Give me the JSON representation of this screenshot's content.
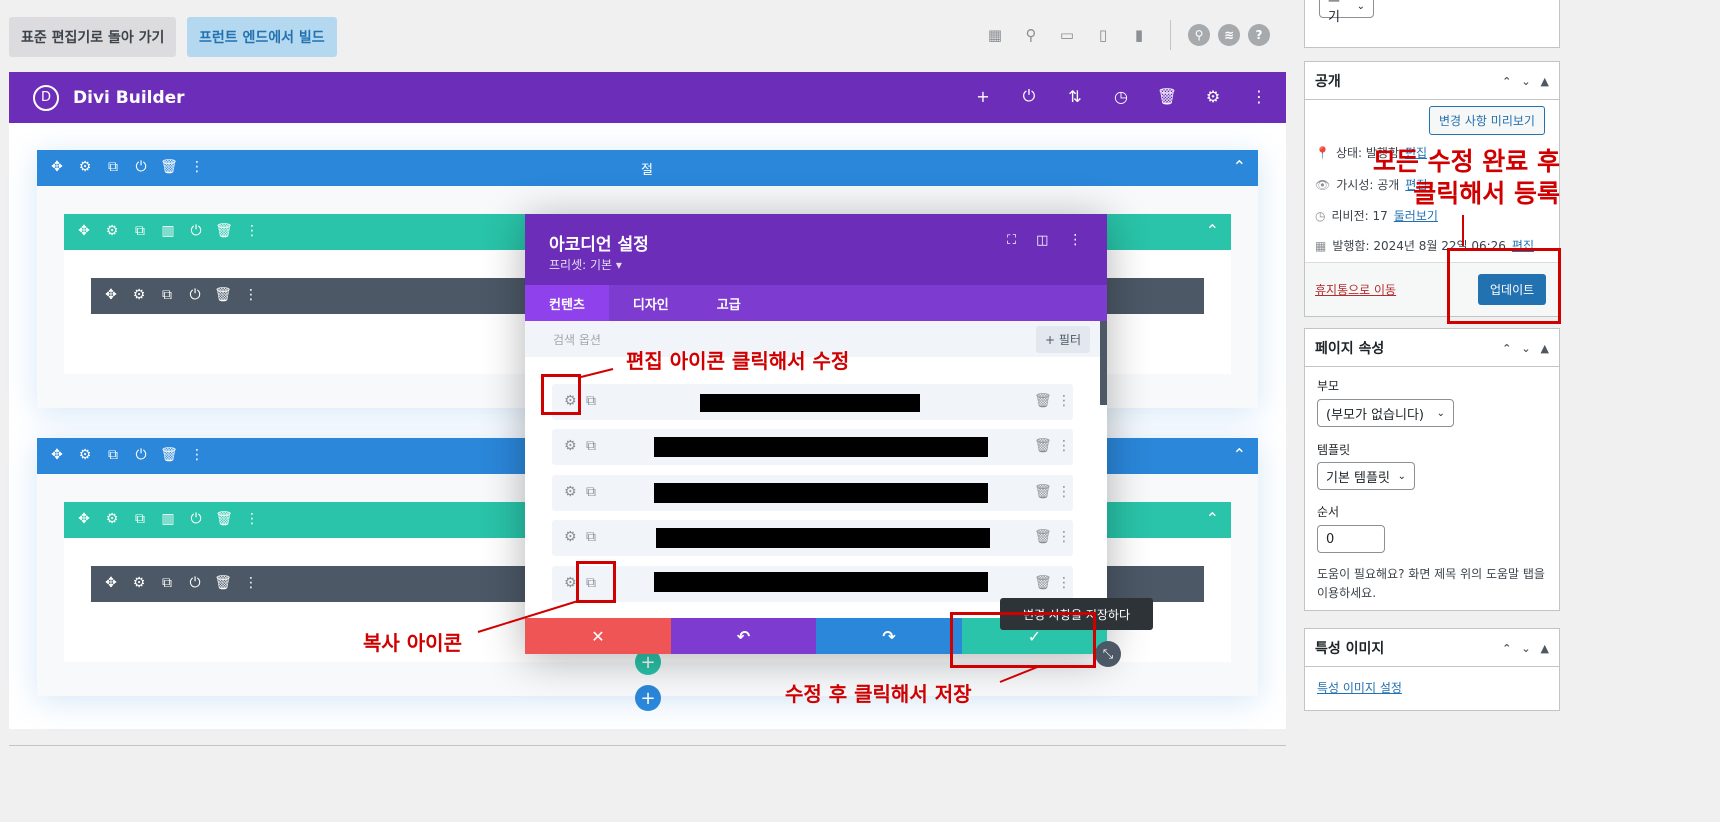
{
  "toolbar": {
    "back_label": "표준 편집기로 돌아 가기",
    "frontend_label": "프런트 엔드에서 빌드",
    "help_icon": "?"
  },
  "divi": {
    "title": "Divi Builder",
    "logo": "D",
    "section_label": "절"
  },
  "modal": {
    "title": "아코디언 설정",
    "preset": "프리셋: 기본 ▾",
    "tabs": [
      "컨텐츠",
      "디자인",
      "고급"
    ],
    "search_placeholder": "검색 옵션",
    "filter_label": "+ 필터",
    "tooltip": "변경 사항을 저장하다"
  },
  "sidebar": {
    "top_select": "끄기",
    "publish": {
      "title": "공개",
      "preview_btn": "변경 사항 미리보기",
      "status_label": "상태: 발행함",
      "status_link": "편집",
      "visibility_label": "가시성: 공개",
      "visibility_link": "편집",
      "revisions_label": "리비전: 17",
      "revisions_link": "둘러보기",
      "published_label": "발행함: 2024년 8월 22일 06:26",
      "published_link": "편집",
      "trash_link": "휴지통으로 이동",
      "update_btn": "업데이트"
    },
    "page_attr": {
      "title": "페이지 속성",
      "parent_label": "부모",
      "parent_value": "(부모가 없습니다)",
      "template_label": "템플릿",
      "template_value": "기본 템플릿",
      "order_label": "순서",
      "order_value": "0",
      "help_text": "도움이 필요해요? 화면 제목 위의 도움말 탭을 이용하세요."
    },
    "featured": {
      "title": "특성 이미지",
      "link": "특성 이미지 설정"
    }
  },
  "annotations": {
    "edit_icon": "편집 아이콘 클릭해서 수정",
    "copy_icon": "복사 아이콘",
    "save": "수정 후 클릭해서 저장",
    "update_line1": "모든 수정 완료 후",
    "update_line2": "클릭해서 등록"
  },
  "colors": {
    "divi_purple": "#6c2eb9",
    "section_blue": "#2b87da",
    "row_teal": "#29c4a9",
    "module_gray": "#4c5866",
    "cancel_red": "#ef5555",
    "save_green": "#29c4a9",
    "annotation_red": "#d00000"
  }
}
